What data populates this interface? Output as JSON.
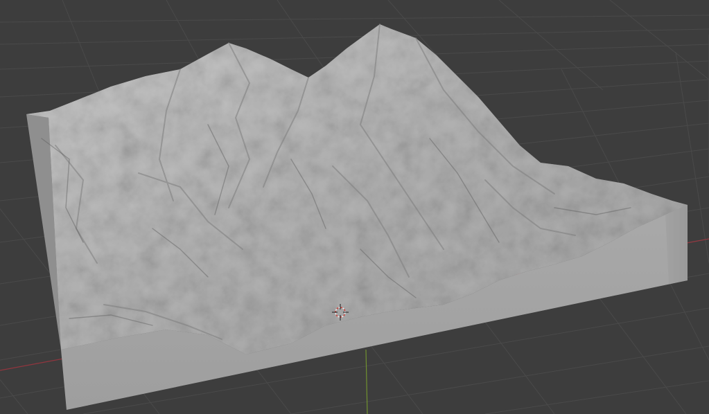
{
  "viewport": {
    "mode": "3d-viewport",
    "shading": "solid",
    "background_color": "#3d3d3d",
    "grid_color": "#4a4a4a",
    "x_axis_color": "#a8343f",
    "y_axis_color": "#7da62c"
  },
  "scene": {
    "objects": [
      {
        "name": "terrain-mesh",
        "type": "landscape",
        "material_color": "#b4b4b4"
      },
      {
        "name": "3d-cursor",
        "type": "cursor"
      }
    ]
  }
}
